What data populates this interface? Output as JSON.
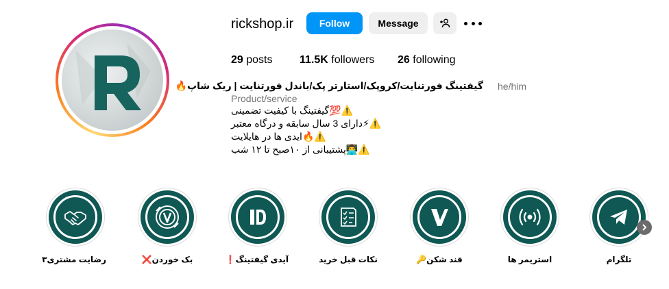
{
  "profile": {
    "username": "rickshop.ir",
    "follow_label": "Follow",
    "message_label": "Message",
    "stats": {
      "posts_count": "29",
      "posts_label": "posts",
      "followers_count": "11.5K",
      "followers_label": "followers",
      "following_count": "26",
      "following_label": "following"
    },
    "bio": {
      "name": "گیفتینگ فورتنایت/کروپک/استارتر پک/باندل فورتنایت | ریک شاپ🔥",
      "pronouns": "he/him",
      "category": "Product/service",
      "lines": [
        "⚠️💯گیفتینگ با کیفیت تضمینی",
        "⚠️⚡دارای 3 سال سابقه و درگاه معتبر",
        "⚠️🔥ایدی ها در هایلایت",
        "⚠️👨‍💻پشتیبانی از ۱۰صبح تا ۱۲ شب"
      ]
    }
  },
  "highlights": [
    {
      "label": "رضایت مشتری۳",
      "icon": "handshake-icon"
    },
    {
      "label": "بک خوردن❌",
      "icon": "v-bucks-icon"
    },
    {
      "label": "آیدی گیفتینگ❗",
      "icon": "id-icon"
    },
    {
      "label": "نکات قبل خرید",
      "icon": "checklist-icon"
    },
    {
      "label": "قند شکن🔑",
      "icon": "v-logo-icon"
    },
    {
      "label": "استریمر ها",
      "icon": "broadcast-icon"
    },
    {
      "label": "تلگرام",
      "icon": "telegram-icon"
    }
  ],
  "colors": {
    "follow_button": "#0095f6",
    "highlight_teal": "#0f5854",
    "avatar_logo": "#17645f"
  }
}
